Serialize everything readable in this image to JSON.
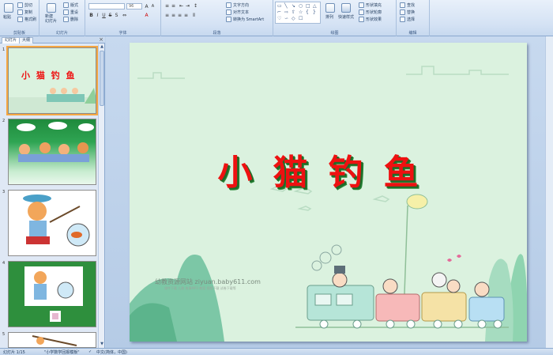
{
  "ribbon": {
    "clipboard": {
      "paste": "粘贴",
      "cut": "剪切",
      "copy": "复制",
      "format_painter": "格式刷",
      "label": "剪贴板"
    },
    "slides": {
      "new_slide": "新建\n幻灯片",
      "layout": "版式",
      "reset": "重设",
      "delete": "删除",
      "label": "幻灯片"
    },
    "font": {
      "font_name": "",
      "font_size": "96",
      "label": "字体"
    },
    "paragraph": {
      "text_direction": "文字方向",
      "align_text": "对齐文本",
      "convert_smartart": "转换为 SmartArt",
      "label": "段落"
    },
    "drawing": {
      "arrange": "排列",
      "quick_styles": "快速样式",
      "shape_fill": "形状填充",
      "shape_outline": "形状轮廓",
      "shape_effects": "形状效果",
      "label": "绘图"
    },
    "editing": {
      "find": "查找",
      "replace": "替换",
      "select": "选择",
      "label": "编辑"
    }
  },
  "pane": {
    "tabs": [
      "幻灯片",
      "大纲"
    ],
    "close": "×",
    "slide_numbers": [
      "1",
      "2",
      "3",
      "4",
      "5"
    ],
    "thumb1_title": "小 猫 钓 鱼"
  },
  "slide": {
    "title": "小猫钓鱼",
    "watermark": "幼教资源网站  ziyuan.baby611.com",
    "watermark_sub": "课件下载  儿歌  故事MP3  教案  视频下载  试卷下载等"
  },
  "status": {
    "slide_count": "幻灯片 1/15",
    "theme": "\"小学数学回报模板\"",
    "language": "中文(简体，中国)"
  },
  "colors": {
    "slide_bg": "#dbf2df",
    "title_red": "#ee1111",
    "title_shadow": "#1f6b2a",
    "selection": "#f5a742"
  }
}
